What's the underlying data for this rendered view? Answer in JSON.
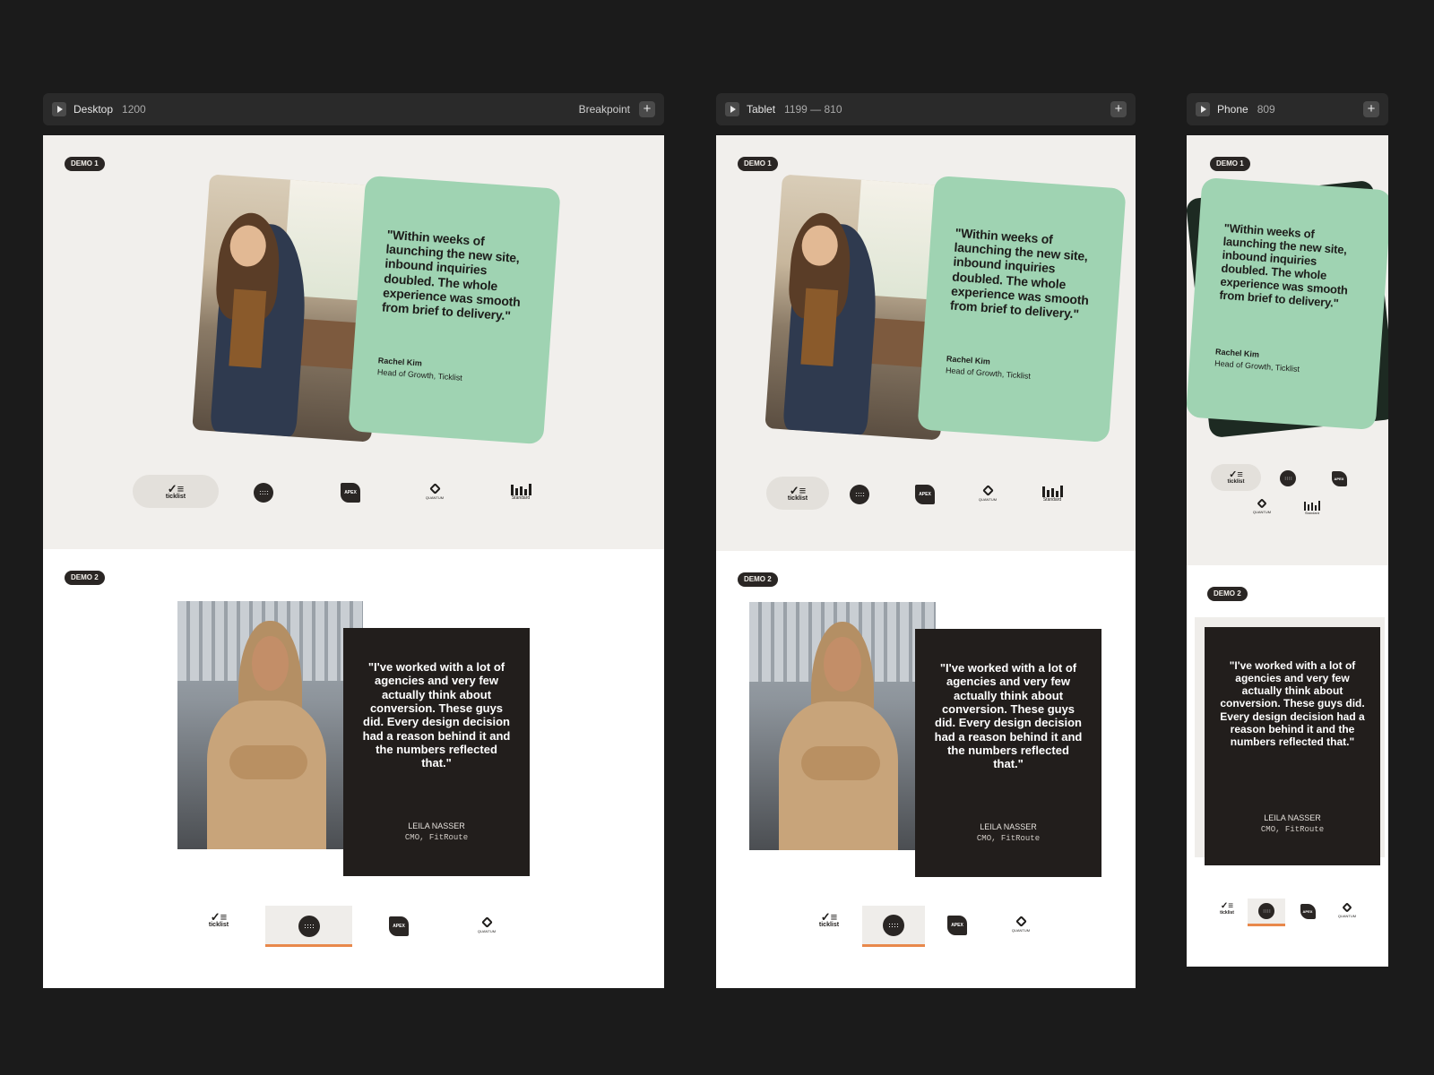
{
  "breakpoints": {
    "desktop": {
      "name": "Desktop",
      "width": "1200",
      "label": "Breakpoint"
    },
    "tablet": {
      "name": "Tablet",
      "width": "1199 — 810"
    },
    "phone": {
      "name": "Phone",
      "width": "809"
    }
  },
  "demo1": {
    "badge": "DEMO 1",
    "quote": "\"Within weeks of launching the new site, inbound inquiries doubled. The whole experience was smooth from brief to delivery.\"",
    "name": "Rachel Kim",
    "role": "Head of Growth, Ticklist"
  },
  "demo2": {
    "badge": "DEMO 2",
    "quote": "\"I've worked with a lot of agencies and very few actually think about conversion. These guys did. Every design decision had a reason behind it and the numbers reflected that.\"",
    "name": "LEILA NASSER",
    "role": "CMO, FitRoute"
  },
  "logos": {
    "ticklist": "ticklist",
    "apex": "APEX",
    "quantum": "QUANTUM",
    "standard": "Standard"
  },
  "colors": {
    "canvas": "#1b1b1b",
    "section1": "#f1efec",
    "green_card": "#9fd3b2",
    "dark_card": "#221e1c",
    "accent": "#e8884b"
  }
}
